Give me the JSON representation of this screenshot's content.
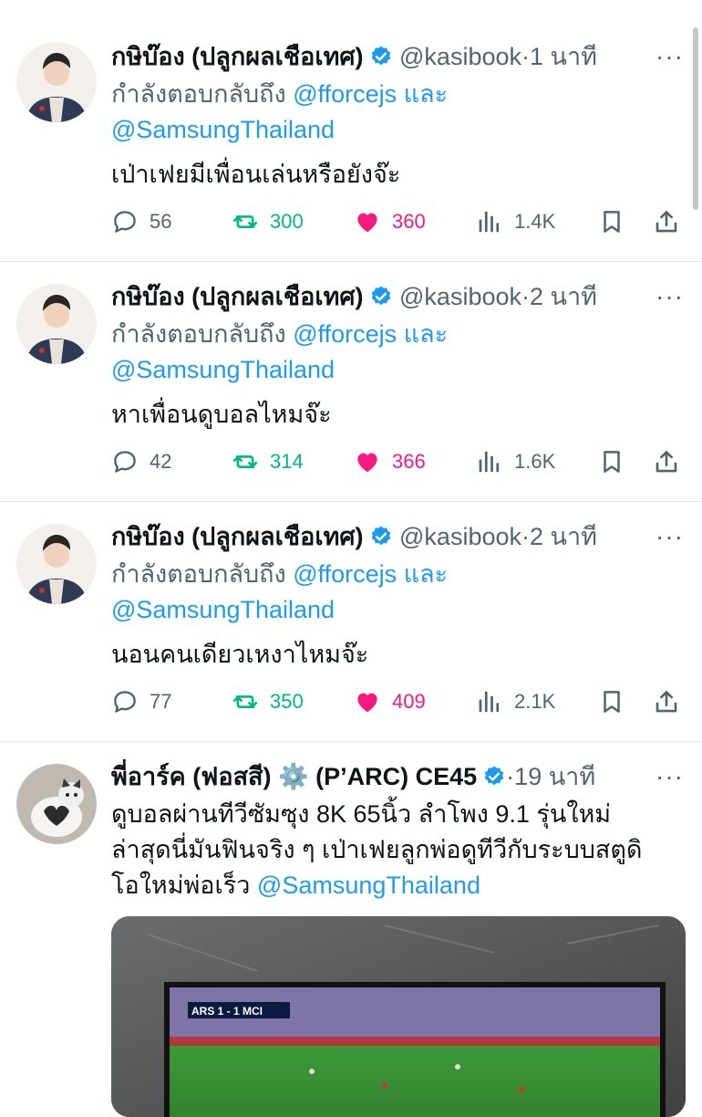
{
  "tweets": [
    {
      "name": "กษิบ๊อง (ปลูกผลเชือเทศ)",
      "handle": "@kasibook",
      "dot": "·",
      "time": "1 นาที",
      "reply_prefix": "กำลังตอบกลับถึง",
      "reply_user1": "@fforcejs",
      "reply_and": "และ",
      "reply_user2": "@SamsungThailand",
      "text": "เป่าเฟยมีเพื่อนเล่นหรือยังจ๊ะ",
      "replies": "56",
      "retweets": "300",
      "likes": "360",
      "views": "1.4K"
    },
    {
      "name": "กษิบ๊อง (ปลูกผลเชือเทศ)",
      "handle": "@kasibook",
      "dot": "·",
      "time": "2 นาที",
      "reply_prefix": "กำลังตอบกลับถึง",
      "reply_user1": "@fforcejs",
      "reply_and": "และ",
      "reply_user2": "@SamsungThailand",
      "text": "หาเพื่อนดูบอลไหมจ๊ะ",
      "replies": "42",
      "retweets": "314",
      "likes": "366",
      "views": "1.6K"
    },
    {
      "name": "กษิบ๊อง (ปลูกผลเชือเทศ)",
      "handle": "@kasibook",
      "dot": "·",
      "time": "2 นาที",
      "reply_prefix": "กำลังตอบกลับถึง",
      "reply_user1": "@fforcejs",
      "reply_and": "และ",
      "reply_user2": "@SamsungThailand",
      "text": "นอนคนเดียวเหงาไหมจ๊ะ",
      "replies": "77",
      "retweets": "350",
      "likes": "409",
      "views": "2.1K"
    },
    {
      "name": "พี่อาร์ค (ฟอสสี) ⚙️ (P’ARC) CE45",
      "dot": "·",
      "time": "19 นาที",
      "text_lines": [
        "ดูบอลผ่านทีวีซัมซุง  8K  65นิ้ว ลำโพง 9.1 รุ่นใหม่",
        "ล่าสุดนี่มันฟินจริง ๆ  เป่าเฟยลูกพ่อดูทีวีกับระบบสตูดิ",
        "โอใหม่พ่อเร็ว"
      ],
      "mention": "@SamsungThailand",
      "media_scoreboard": "ARS 1 - 1 MCI"
    }
  ],
  "more_label": "···",
  "colors": {
    "accent": "#1d9bf0",
    "retweet": "#00ba7c",
    "like": "#f91880",
    "secondary_text": "#536471"
  }
}
